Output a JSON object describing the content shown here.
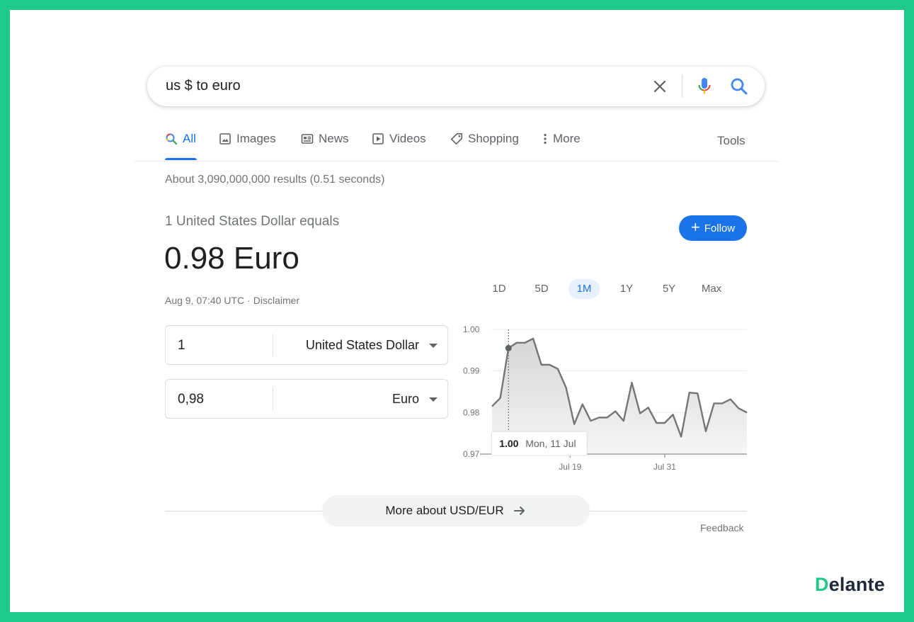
{
  "search": {
    "query": "us $ to euro"
  },
  "tabs": [
    {
      "label": "All",
      "icon": "search-icon"
    },
    {
      "label": "Images",
      "icon": "image-icon"
    },
    {
      "label": "News",
      "icon": "news-icon"
    },
    {
      "label": "Videos",
      "icon": "video-icon"
    },
    {
      "label": "Shopping",
      "icon": "tag-icon"
    },
    {
      "label": "More",
      "icon": "more-vert-icon"
    }
  ],
  "tools_label": "Tools",
  "stats": "About 3,090,000,000 results (0.51 seconds)",
  "converter": {
    "equals_label": "1 United States Dollar equals",
    "result": "0.98 Euro",
    "timestamp": "Aug 9, 07:40 UTC",
    "disclaimer": "Disclaimer",
    "follow_label": "Follow",
    "from": {
      "amount": "1",
      "currency": "United States Dollar"
    },
    "to": {
      "amount": "0,98",
      "currency": "Euro"
    }
  },
  "ranges": [
    {
      "label": "1D",
      "active": false
    },
    {
      "label": "5D",
      "active": false
    },
    {
      "label": "1M",
      "active": true
    },
    {
      "label": "1Y",
      "active": false
    },
    {
      "label": "5Y",
      "active": false
    },
    {
      "label": "Max",
      "active": false
    }
  ],
  "chart_data": {
    "type": "area",
    "x_day_offsets": [
      0,
      1,
      2,
      3,
      4,
      5,
      6,
      7,
      8,
      9,
      10,
      11,
      12,
      13,
      14,
      15,
      16,
      17,
      18,
      19,
      20,
      21,
      22,
      23,
      24,
      25,
      26,
      27,
      28,
      29,
      30,
      31,
      32
    ],
    "values": [
      0.9815,
      0.9835,
      0.9955,
      0.9968,
      0.9968,
      0.9978,
      0.9915,
      0.9915,
      0.9905,
      0.986,
      0.9772,
      0.982,
      0.978,
      0.9788,
      0.9788,
      0.9803,
      0.978,
      0.9872,
      0.9798,
      0.9812,
      0.9775,
      0.9775,
      0.9795,
      0.9742,
      0.9848,
      0.9846,
      0.9755,
      0.9822,
      0.9822,
      0.9832,
      0.981,
      0.98
    ],
    "yticks": [
      "1.00",
      "0.99",
      "0.98",
      "0.97"
    ],
    "ytick_values": [
      1.0,
      0.99,
      0.98,
      0.97
    ],
    "ylim": [
      0.97,
      1.0
    ],
    "xticks": [
      "Jul 19",
      "Jul 31"
    ],
    "xtick_index": [
      9.5,
      21
    ],
    "tooltip": {
      "value": "1.00",
      "date": "Mon, 11 Jul",
      "index": 2
    },
    "colors": {
      "line": "#757575",
      "fill_top": "#d4d5d6",
      "fill_bottom": "#f6f6f6",
      "grid": "#ebebeb",
      "axis": "#9aa0a6"
    }
  },
  "more_label": "More about USD/EUR",
  "feedback_label": "Feedback",
  "logo": {
    "first": "D",
    "rest": "elante"
  }
}
